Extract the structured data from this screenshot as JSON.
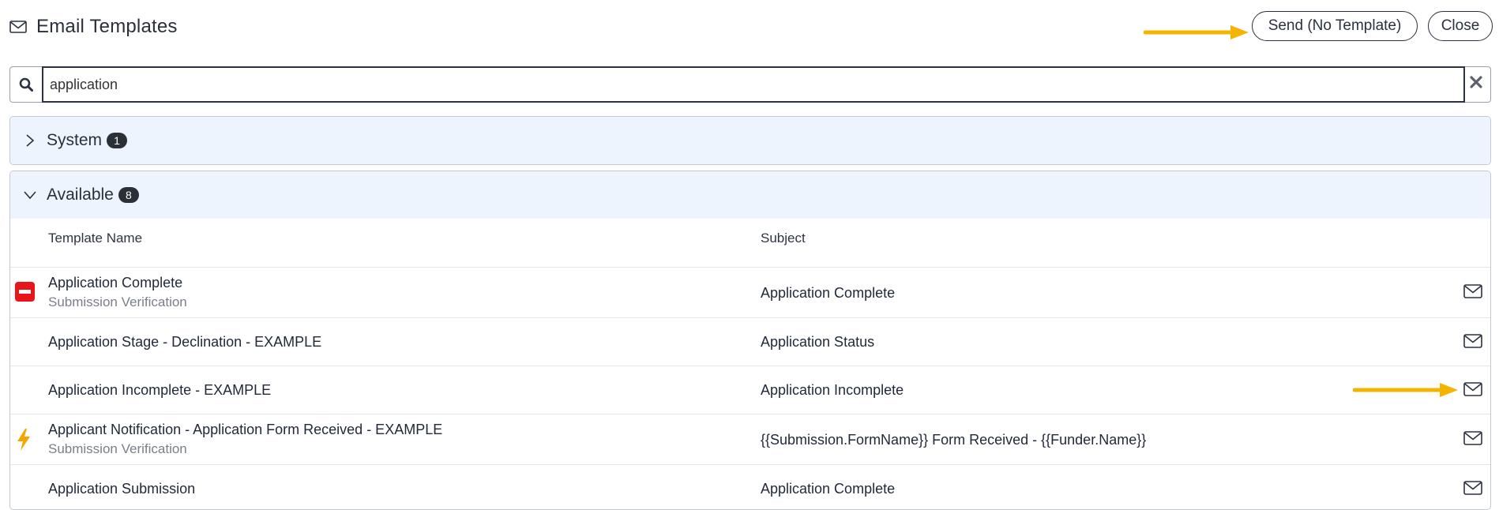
{
  "header": {
    "title": "Email Templates",
    "send_no_template_label": "Send (No Template)",
    "close_label": "Close"
  },
  "search": {
    "value": "application",
    "placeholder": ""
  },
  "sections": [
    {
      "label": "System",
      "count": "1",
      "expanded": false
    },
    {
      "label": "Available",
      "count": "8",
      "expanded": true
    }
  ],
  "table": {
    "columns": [
      "Template Name",
      "Subject"
    ],
    "rows": [
      {
        "name": "Application Complete",
        "sub": "Submission Verification",
        "subject": "Application Complete",
        "flag": "blocked-icon"
      },
      {
        "name": "Application Stage - Declination - EXAMPLE",
        "sub": "",
        "subject": "Application Status",
        "flag": ""
      },
      {
        "name": "Application Incomplete - EXAMPLE",
        "sub": "",
        "subject": "Application Incomplete",
        "flag": ""
      },
      {
        "name": "Applicant Notification - Application Form Received - EXAMPLE",
        "sub": "Submission Verification",
        "subject": "{{Submission.FormName}} Form Received - {{Funder.Name}}",
        "flag": "lightning-icon"
      },
      {
        "name": "Application Submission",
        "sub": "",
        "subject": "Application Complete",
        "flag": ""
      }
    ]
  },
  "colors": {
    "accent_arrow": "#f5b400",
    "blocked_red": "#e8161b",
    "lightning_orange": "#f2a600",
    "section_bg": "#eef4fd",
    "dark": "#2b3140"
  },
  "icons": [
    "envelope-icon",
    "search-icon",
    "close-x-icon",
    "chevron-right-icon",
    "chevron-down-icon",
    "blocked-icon",
    "lightning-icon",
    "arrow-icon"
  ]
}
